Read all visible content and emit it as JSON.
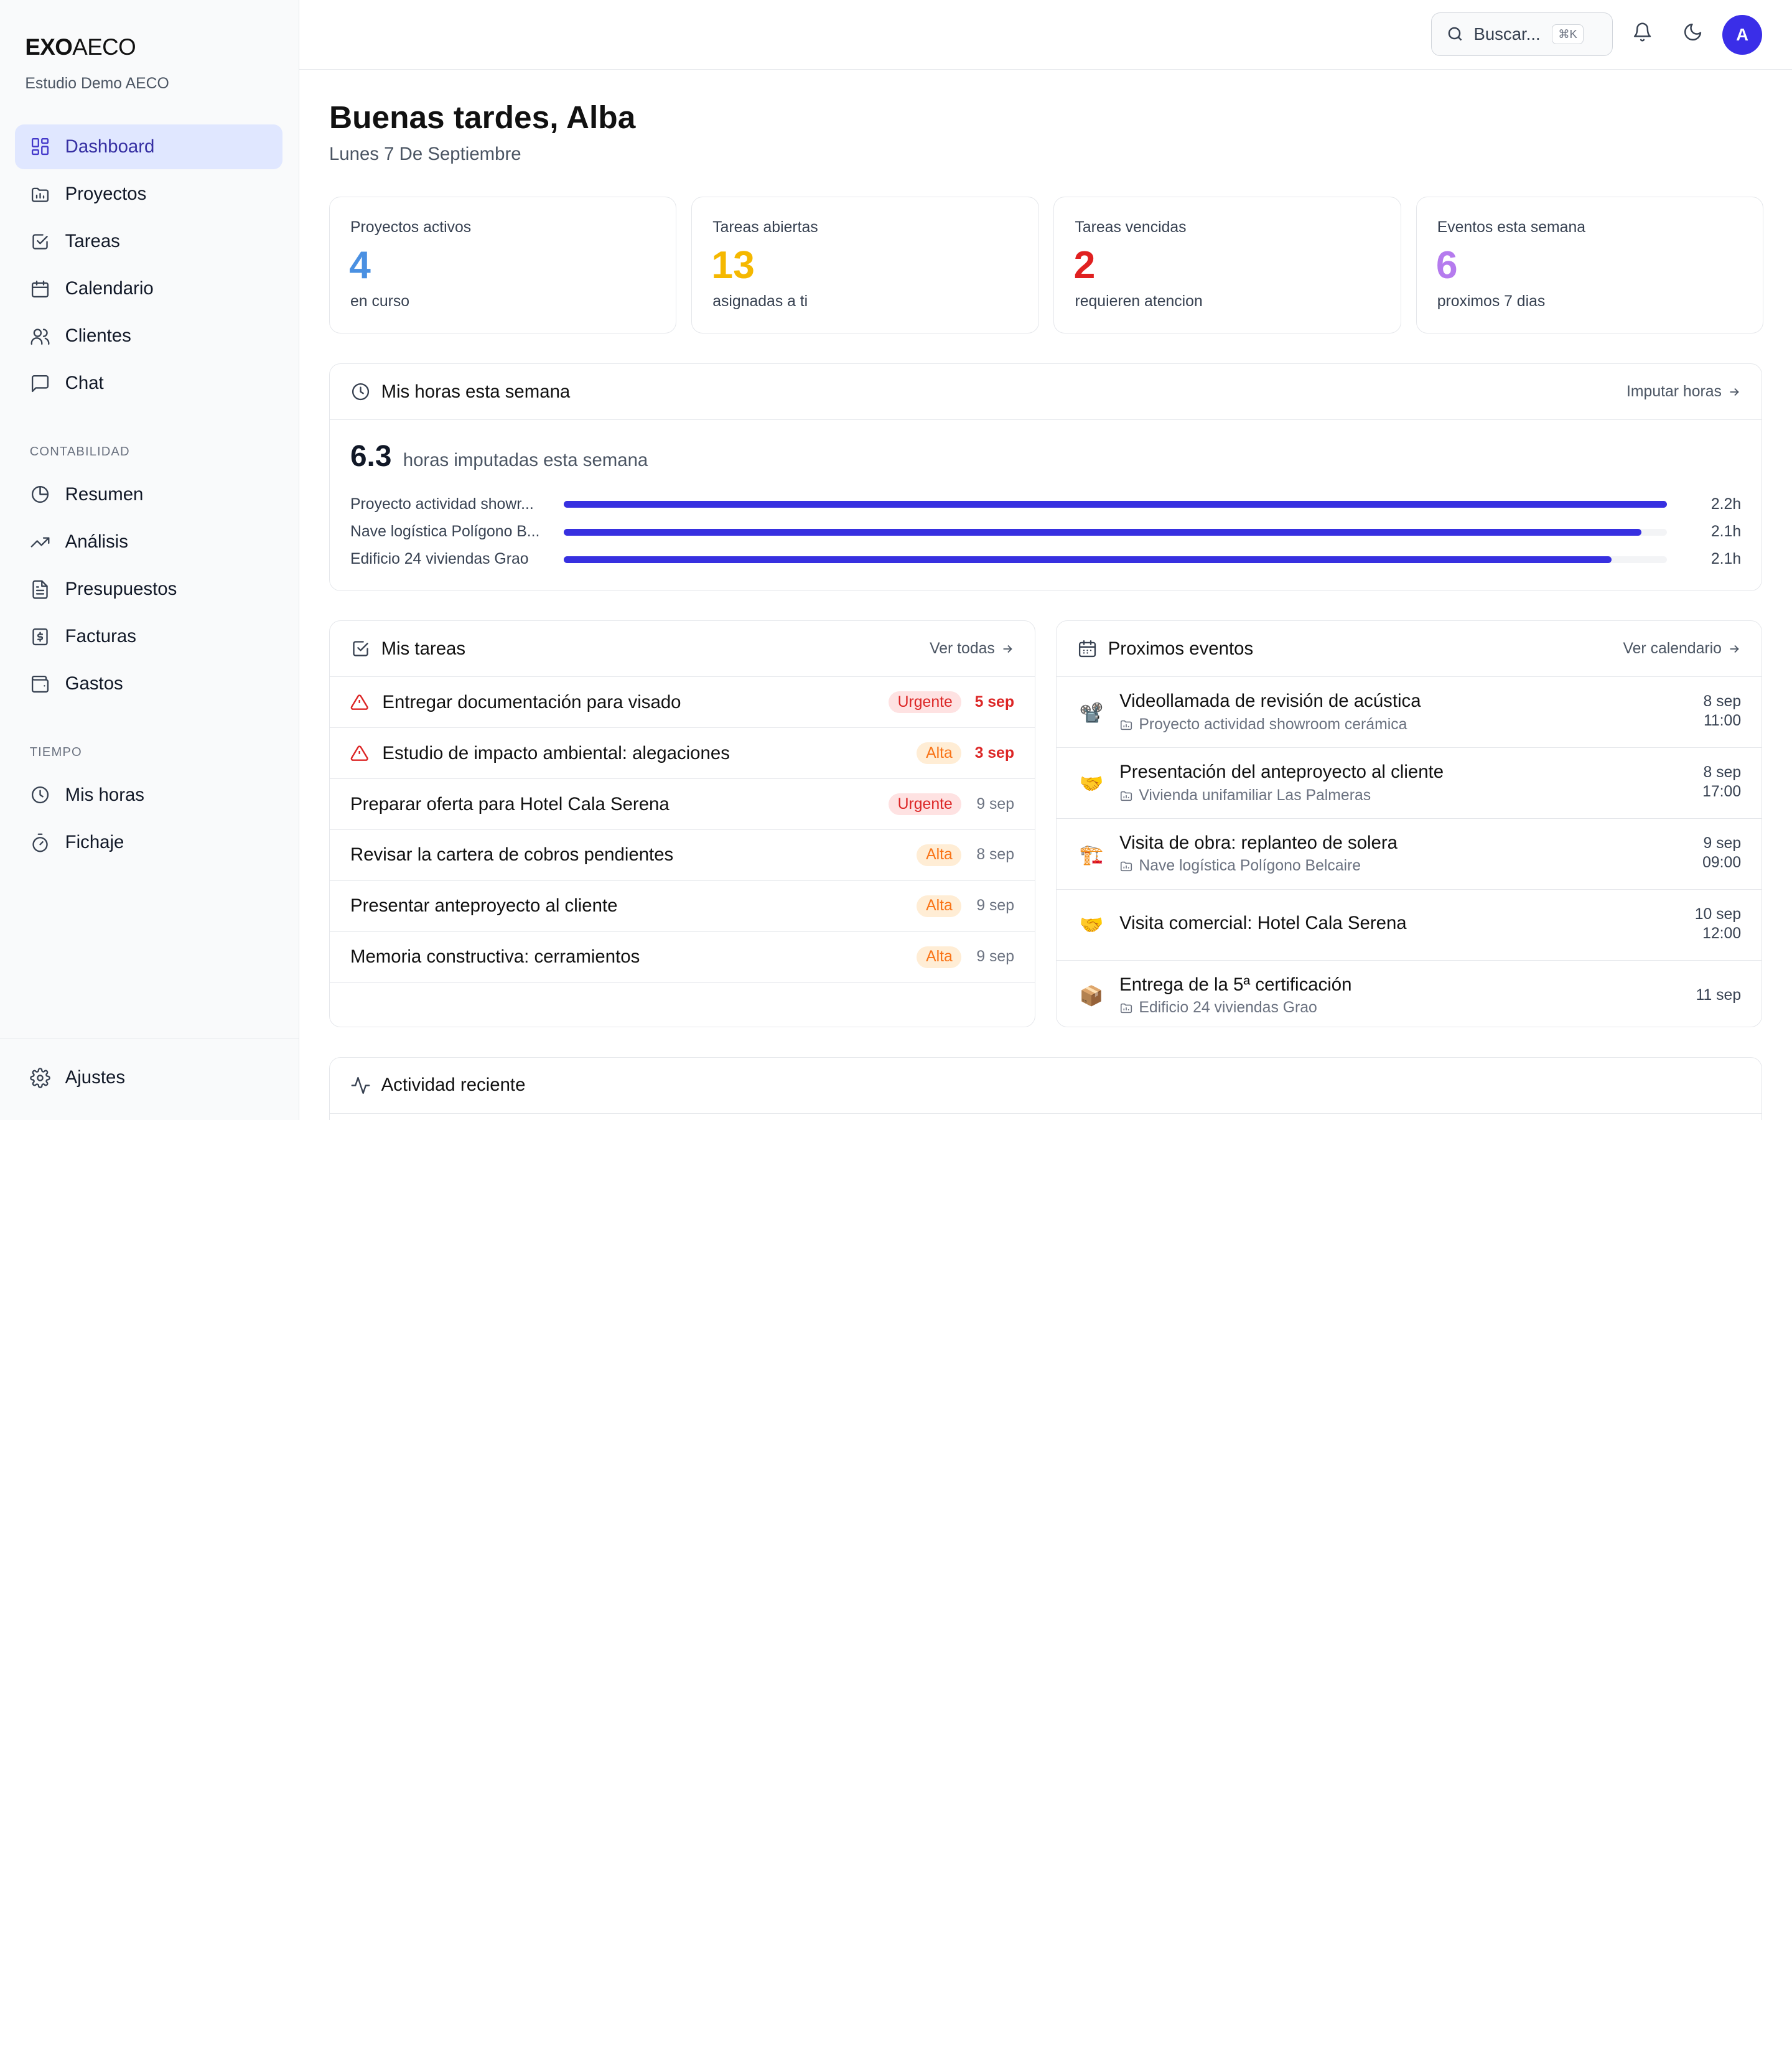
{
  "brand": {
    "bold": "EXO",
    "light": "AECO"
  },
  "org": "Estudio Demo AECO",
  "nav": {
    "main": [
      {
        "label": "Dashboard",
        "icon": "dashboard-icon",
        "active": true
      },
      {
        "label": "Proyectos",
        "icon": "folder-icon"
      },
      {
        "label": "Tareas",
        "icon": "check-square-icon"
      },
      {
        "label": "Calendario",
        "icon": "calendar-icon"
      },
      {
        "label": "Clientes",
        "icon": "users-icon"
      },
      {
        "label": "Chat",
        "icon": "chat-icon"
      }
    ],
    "contabilidad_label": "CONTABILIDAD",
    "contabilidad": [
      {
        "label": "Resumen",
        "icon": "pie-chart-icon"
      },
      {
        "label": "Análisis",
        "icon": "trending-up-icon"
      },
      {
        "label": "Presupuestos",
        "icon": "document-icon"
      },
      {
        "label": "Facturas",
        "icon": "invoice-icon"
      },
      {
        "label": "Gastos",
        "icon": "wallet-icon"
      }
    ],
    "tiempo_label": "TIEMPO",
    "tiempo": [
      {
        "label": "Mis horas",
        "icon": "clock-icon"
      },
      {
        "label": "Fichaje",
        "icon": "stopwatch-icon"
      }
    ],
    "footer": {
      "label": "Ajustes",
      "icon": "gear-icon"
    }
  },
  "topbar": {
    "search_placeholder": "Buscar...",
    "search_shortcut": "⌘K",
    "avatar_initial": "A"
  },
  "greeting": "Buenas tardes, Alba",
  "date": "Lunes 7 De Septiembre",
  "stats": [
    {
      "label": "Proyectos activos",
      "value": "4",
      "sub": "en curso",
      "color": "#4a90e2"
    },
    {
      "label": "Tareas abiertas",
      "value": "13",
      "sub": "asignadas a ti",
      "color": "#f5b800"
    },
    {
      "label": "Tareas vencidas",
      "value": "2",
      "sub": "requieren atencion",
      "color": "#e02020"
    },
    {
      "label": "Eventos esta semana",
      "value": "6",
      "sub": "proximos 7 dias",
      "color": "#b57bee"
    }
  ],
  "hours": {
    "title": "Mis horas esta semana",
    "link": "Imputar horas",
    "total": "6.3",
    "total_label": "horas imputadas esta semana",
    "rows": [
      {
        "name": "Proyecto actividad showr...",
        "value": "2.2h",
        "fraction": 1.0
      },
      {
        "name": "Nave logística Polígono B...",
        "value": "2.1h",
        "fraction": 0.977
      },
      {
        "name": "Edificio 24 viviendas Grao",
        "value": "2.1h",
        "fraction": 0.95
      }
    ]
  },
  "tasks": {
    "title": "Mis tareas",
    "link": "Ver todas",
    "items": [
      {
        "title": "Entregar documentación para visado",
        "badge": "Urgente",
        "kind": "urg",
        "date": "5 sep",
        "overdue": true
      },
      {
        "title": "Estudio de impacto ambiental: alegaciones",
        "badge": "Alta",
        "kind": "alta",
        "date": "3 sep",
        "overdue": true
      },
      {
        "title": "Preparar oferta para Hotel Cala Serena",
        "badge": "Urgente",
        "kind": "urg",
        "date": "9 sep",
        "overdue": false
      },
      {
        "title": "Revisar la cartera de cobros pendientes",
        "badge": "Alta",
        "kind": "alta",
        "date": "8 sep",
        "overdue": false
      },
      {
        "title": "Presentar anteproyecto al cliente",
        "badge": "Alta",
        "kind": "alta",
        "date": "9 sep",
        "overdue": false
      },
      {
        "title": "Memoria constructiva: cerramientos",
        "badge": "Alta",
        "kind": "alta",
        "date": "9 sep",
        "overdue": false
      }
    ]
  },
  "events": {
    "title": "Proximos eventos",
    "link": "Ver calendario",
    "items": [
      {
        "emoji": "📽️",
        "title": "Videollamada de revisión de acústica",
        "project": "Proyecto actividad showroom cerámica",
        "day": "8 sep",
        "time": "11:00"
      },
      {
        "emoji": "🤝",
        "title": "Presentación del anteproyecto al cliente",
        "project": "Vivienda unifamiliar Las Palmeras",
        "day": "8 sep",
        "time": "17:00"
      },
      {
        "emoji": "🏗️",
        "title": "Visita de obra: replanteo de solera",
        "project": "Nave logística Polígono Belcaire",
        "day": "9 sep",
        "time": "09:00"
      },
      {
        "emoji": "🤝",
        "title": "Visita comercial: Hotel Cala Serena",
        "project": "",
        "day": "10 sep",
        "time": "12:00"
      },
      {
        "emoji": "📦",
        "title": "Entrega de la 5ª certificación",
        "project": "Edificio 24 viviendas Grao",
        "day": "11 sep",
        "time": ""
      }
    ]
  },
  "activity": {
    "title": "Actividad reciente"
  }
}
